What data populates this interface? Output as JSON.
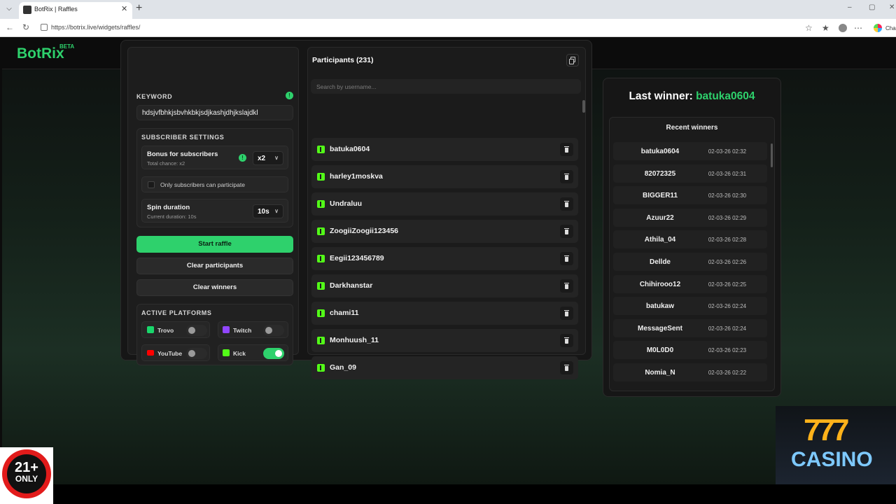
{
  "browser": {
    "tab_title": "BotRix | Raffles",
    "url": "https://botrix.live/widgets/raffles/",
    "edge_tail": "Cha"
  },
  "brand": {
    "logo": "BotRix",
    "badge": "BETA"
  },
  "keyword": {
    "label": "KEYWORD",
    "value": "hdsjvfbhkjsbvhkbkjsdjkashjdhjkslajdkl"
  },
  "subscriber_settings": {
    "label": "SUBSCRIBER SETTINGS",
    "bonus_title": "Bonus for subscribers",
    "bonus_sub": "Total chance: x2",
    "bonus_value": "x2",
    "only_subs_label": "Only subscribers can participate",
    "spin_title": "Spin duration",
    "spin_sub": "Current duration: 10s",
    "spin_value": "10s"
  },
  "buttons": {
    "start": "Start raffle",
    "clear_participants": "Clear participants",
    "clear_winners": "Clear winners"
  },
  "platforms": {
    "label": "ACTIVE PLATFORMS",
    "items": [
      {
        "name": "Trovo",
        "enabled": false,
        "color": "#19d66b"
      },
      {
        "name": "Twitch",
        "enabled": false,
        "color": "#9146ff"
      },
      {
        "name": "YouTube",
        "enabled": false,
        "color": "#ff0000"
      },
      {
        "name": "Kick",
        "enabled": true,
        "color": "#53fc18"
      }
    ]
  },
  "participants": {
    "title": "Participants (231)",
    "search_placeholder": "Search by username...",
    "list": [
      "batuka0604",
      "harley1moskva",
      "Undraluu",
      "ZoogiiZoogii123456",
      "Eegii123456789",
      "Darkhanstar",
      "chami11",
      "Monhuush_11",
      "Gan_09"
    ]
  },
  "winners": {
    "last_prefix": "Last winner: ",
    "last_name": "batuka0604",
    "recent_title": "Recent winners",
    "list": [
      {
        "name": "batuka0604",
        "time": "02-03-26 02:32"
      },
      {
        "name": "82072325",
        "time": "02-03-26 02:31"
      },
      {
        "name": "BIGGER11",
        "time": "02-03-26 02:30"
      },
      {
        "name": "Azuur22",
        "time": "02-03-26 02:29"
      },
      {
        "name": "Athila_04",
        "time": "02-03-26 02:28"
      },
      {
        "name": "Dellde",
        "time": "02-03-26 02:26"
      },
      {
        "name": "Chihirooo12",
        "time": "02-03-26 02:25"
      },
      {
        "name": "batukaw",
        "time": "02-03-26 02:24"
      },
      {
        "name": "MessageSent",
        "time": "02-03-26 02:24"
      },
      {
        "name": "M0L0D0",
        "time": "02-03-26 02:23"
      },
      {
        "name": "Nomia_N",
        "time": "02-03-26 02:22"
      }
    ]
  },
  "overlays": {
    "age_num": "21+",
    "age_only": "ONLY",
    "casino_num": "777",
    "casino_word": "CASINO"
  },
  "colors": {
    "accent": "#2ed16c",
    "kick": "#53fc18"
  }
}
